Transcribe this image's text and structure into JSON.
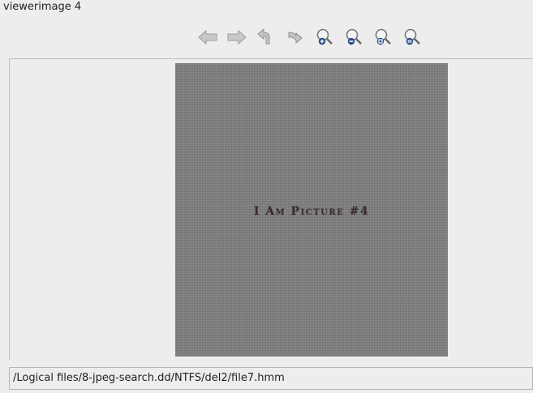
{
  "window": {
    "title": "viewerimage 4"
  },
  "toolbar": {
    "buttons": [
      {
        "name": "back-button",
        "icon": "arrow-left-icon"
      },
      {
        "name": "forward-button",
        "icon": "arrow-right-icon"
      },
      {
        "name": "rotate-left-button",
        "icon": "rotate-left-icon"
      },
      {
        "name": "rotate-right-button",
        "icon": "rotate-right-icon"
      },
      {
        "name": "zoom-in-button",
        "icon": "zoom-in-icon"
      },
      {
        "name": "zoom-out-button",
        "icon": "zoom-out-icon"
      },
      {
        "name": "zoom-fit-button",
        "icon": "zoom-fit-icon"
      },
      {
        "name": "zoom-original-button",
        "icon": "zoom-original-icon"
      }
    ]
  },
  "image": {
    "text": "I Am Picture #4",
    "background": "#7e7e7e"
  },
  "status": {
    "path": "/Logical files/8-jpeg-search.dd/NTFS/del2/file7.hmm"
  }
}
